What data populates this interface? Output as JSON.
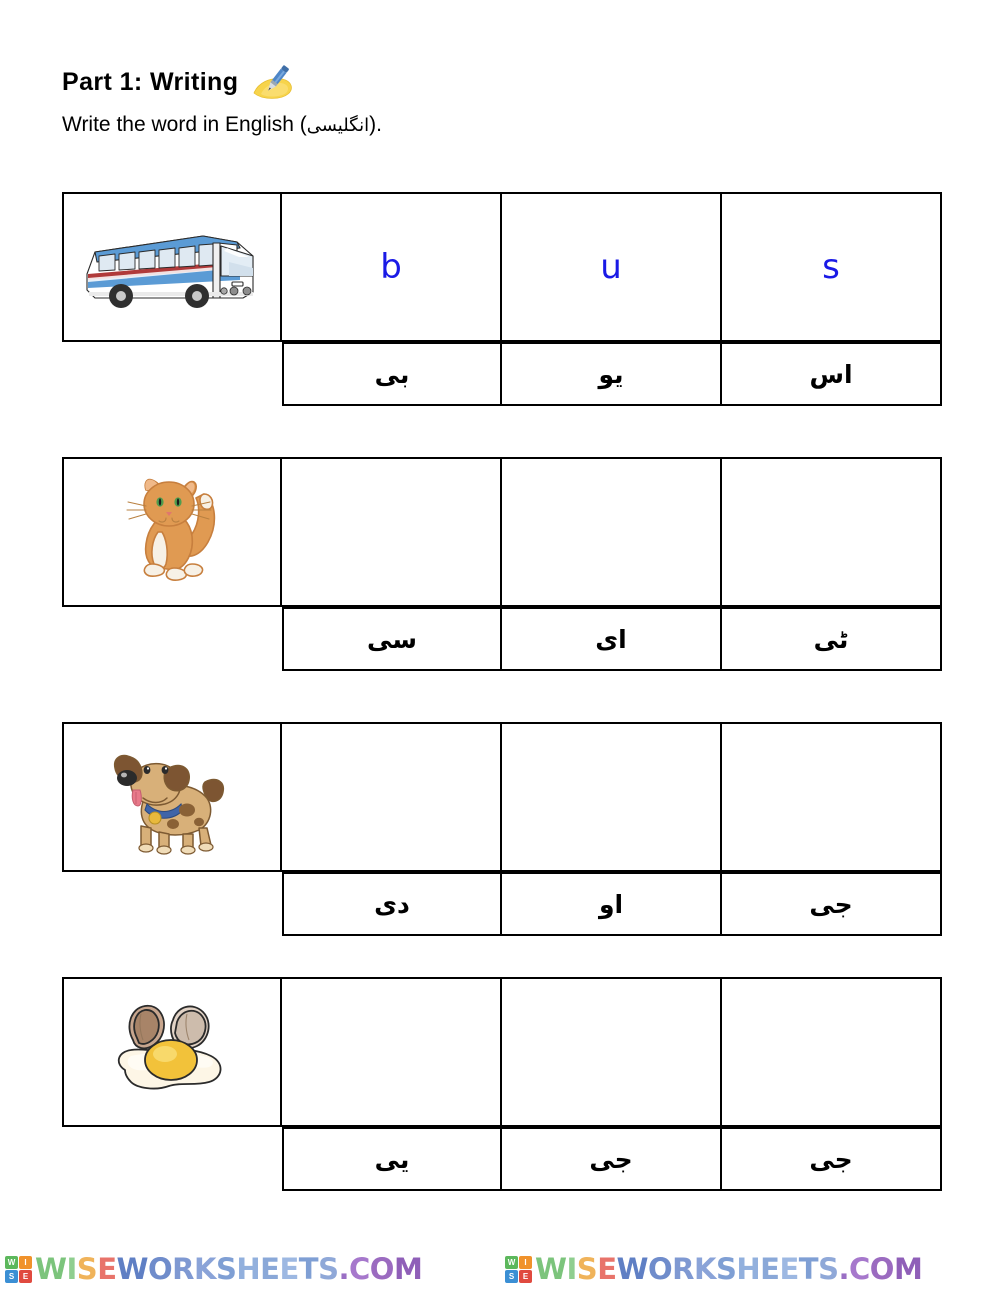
{
  "header": {
    "part_title": "Part 1:  Writing",
    "pen_icon": "pen-writing-icon",
    "instruction_prefix": "Write the word in English (",
    "instruction_urdu": "انگلیسی",
    "instruction_suffix": ")."
  },
  "colors": {
    "letter_blue": "#1a1ae6",
    "border_black": "#000000",
    "page_background": "#ffffff",
    "logo_w_green": "#5cb85c",
    "logo_i_orange": "#f0922b",
    "logo_s_blue": "#3b8fd4",
    "logo_e_red": "#e04a3f"
  },
  "questions": [
    {
      "id": "bus",
      "picture": "bus-image",
      "picture_alt": "bus",
      "letters": [
        "b",
        "u",
        "s"
      ],
      "urdu": [
        "بی",
        "یو",
        "اس"
      ]
    },
    {
      "id": "cat",
      "picture": "cat-image",
      "picture_alt": "cat",
      "letters": [
        "",
        "",
        ""
      ],
      "urdu": [
        "سی",
        "ای",
        "ٹی"
      ]
    },
    {
      "id": "dog",
      "picture": "dog-image",
      "picture_alt": "dog",
      "letters": [
        "",
        "",
        ""
      ],
      "urdu": [
        "دی",
        "او",
        "جی"
      ]
    },
    {
      "id": "egg",
      "picture": "egg-image",
      "picture_alt": "egg",
      "letters": [
        "",
        "",
        ""
      ],
      "urdu": [
        "یی",
        "جی",
        "جی"
      ]
    }
  ],
  "footer": {
    "logo_letters": [
      "W",
      "I",
      "S",
      "E"
    ],
    "watermark_text": "WISEWORKSHEETS.COM",
    "repeat_count": 2
  }
}
